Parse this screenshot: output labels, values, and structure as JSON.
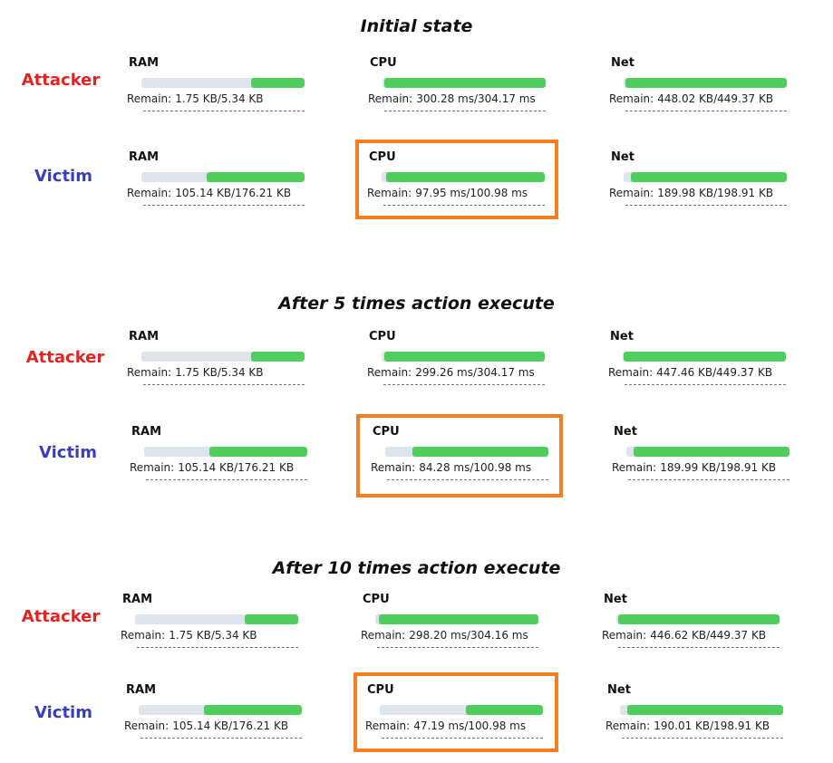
{
  "accent_colors": {
    "attacker": "#e02424",
    "victim": "#3b3fb6",
    "fill": "#4fce5d",
    "track": "#dde4ec",
    "highlight": "#f57f20"
  },
  "remain_label": "Remain:",
  "sections": [
    {
      "title": "Initial state",
      "rows": [
        {
          "role": "Attacker",
          "ram": {
            "label": "RAM",
            "value": "1.75 KB/5.34 KB",
            "fraction": 0.33
          },
          "cpu": {
            "label": "CPU",
            "value": "300.28 ms/304.17 ms",
            "fraction": 0.99
          },
          "net": {
            "label": "Net",
            "value": "448.02 KB/449.37 KB",
            "fraction": 0.99
          }
        },
        {
          "role": "Victim",
          "ram": {
            "label": "RAM",
            "value": "105.14 KB/176.21 KB",
            "fraction": 0.6
          },
          "cpu": {
            "label": "CPU",
            "value": "97.95 ms/100.98 ms",
            "fraction": 0.97
          },
          "net": {
            "label": "Net",
            "value": "189.98 KB/198.91 KB",
            "fraction": 0.955
          }
        }
      ]
    },
    {
      "title": "After 5 times action execute",
      "rows": [
        {
          "role": "Attacker",
          "ram": {
            "label": "RAM",
            "value": "1.75 KB/5.34 KB",
            "fraction": 0.33
          },
          "cpu": {
            "label": "CPU",
            "value": "299.26 ms/304.17 ms",
            "fraction": 0.985
          },
          "net": {
            "label": "Net",
            "value": "447.46 KB/449.37 KB",
            "fraction": 0.995
          }
        },
        {
          "role": "Victim",
          "ram": {
            "label": "RAM",
            "value": "105.14 KB/176.21 KB",
            "fraction": 0.6
          },
          "cpu": {
            "label": "CPU",
            "value": "84.28 ms/100.98 ms",
            "fraction": 0.835
          },
          "net": {
            "label": "Net",
            "value": "189.99 KB/198.91 KB",
            "fraction": 0.955
          }
        }
      ]
    },
    {
      "title": "After 10 times action execute",
      "rows": [
        {
          "role": "Attacker",
          "ram": {
            "label": "RAM",
            "value": "1.75 KB/5.34 KB",
            "fraction": 0.33
          },
          "cpu": {
            "label": "CPU",
            "value": "298.20 ms/304.16 ms",
            "fraction": 0.98
          },
          "net": {
            "label": "Net",
            "value": "446.62 KB/449.37 KB",
            "fraction": 0.99
          }
        },
        {
          "role": "Victim",
          "ram": {
            "label": "RAM",
            "value": "105.14 KB/176.21 KB",
            "fraction": 0.6
          },
          "cpu": {
            "label": "CPU",
            "value": "47.19 ms/100.98 ms",
            "fraction": 0.47
          },
          "net": {
            "label": "Net",
            "value": "190.01 KB/198.91 KB",
            "fraction": 0.955
          }
        }
      ]
    }
  ]
}
